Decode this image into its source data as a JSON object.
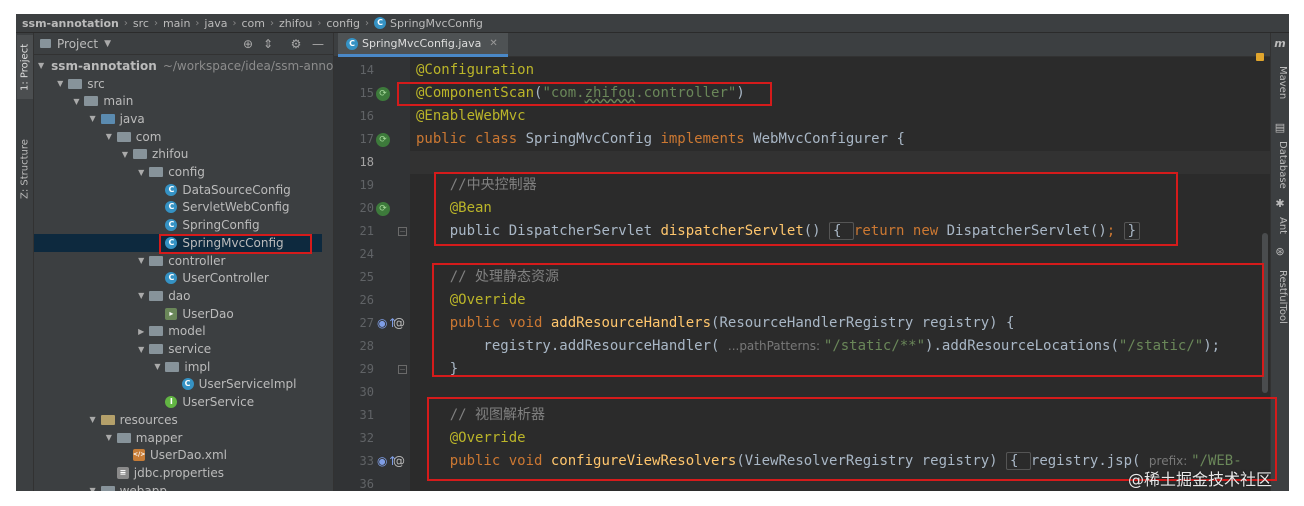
{
  "breadcrumb": [
    "ssm-annotation",
    "src",
    "main",
    "java",
    "com",
    "zhifou",
    "config",
    "SpringMvcConfig"
  ],
  "left_strip": {
    "project_tab": "1: Project",
    "structure_tab": "Z: Structure"
  },
  "project_panel": {
    "title": "Project",
    "tree": [
      {
        "label": "ssm-annotation",
        "path": "~/workspace/idea/ssm-anno",
        "icon": "folder-icon",
        "level": 0,
        "state": "open"
      },
      {
        "label": "src",
        "icon": "folder-icon",
        "level": 1,
        "state": "open"
      },
      {
        "label": "main",
        "icon": "folder-icon",
        "level": 2,
        "state": "open"
      },
      {
        "label": "java",
        "icon": "source-folder-icon",
        "level": 3,
        "state": "open"
      },
      {
        "label": "com",
        "icon": "package-icon",
        "level": 4,
        "state": "open"
      },
      {
        "label": "zhifou",
        "icon": "package-icon",
        "level": 5,
        "state": "open"
      },
      {
        "label": "config",
        "icon": "package-icon",
        "level": 6,
        "state": "open"
      },
      {
        "label": "DataSourceConfig",
        "icon": "class-icon",
        "level": 7,
        "state": "leaf"
      },
      {
        "label": "ServletWebConfig",
        "icon": "class-icon",
        "level": 7,
        "state": "leaf"
      },
      {
        "label": "SpringConfig",
        "icon": "class-icon",
        "level": 7,
        "state": "leaf"
      },
      {
        "label": "SpringMvcConfig",
        "icon": "class-icon",
        "level": 7,
        "state": "leaf",
        "selected": true
      },
      {
        "label": "controller",
        "icon": "package-icon",
        "level": 6,
        "state": "open"
      },
      {
        "label": "UserController",
        "icon": "class-icon",
        "level": 7,
        "state": "leaf"
      },
      {
        "label": "dao",
        "icon": "package-icon",
        "level": 6,
        "state": "open"
      },
      {
        "label": "UserDao",
        "icon": "mapper-icon",
        "level": 7,
        "state": "leaf"
      },
      {
        "label": "model",
        "icon": "package-icon",
        "level": 6,
        "state": "closed"
      },
      {
        "label": "service",
        "icon": "package-icon",
        "level": 6,
        "state": "open"
      },
      {
        "label": "impl",
        "icon": "package-icon",
        "level": 7,
        "state": "open"
      },
      {
        "label": "UserServiceImpl",
        "icon": "class-icon",
        "level": 8,
        "state": "leaf"
      },
      {
        "label": "UserService",
        "icon": "interface-icon",
        "level": 7,
        "state": "leaf"
      },
      {
        "label": "resources",
        "icon": "resources-folder-icon",
        "level": 3,
        "state": "open"
      },
      {
        "label": "mapper",
        "icon": "folder-icon",
        "level": 4,
        "state": "open"
      },
      {
        "label": "UserDao.xml",
        "icon": "xml-icon",
        "level": 5,
        "state": "leaf"
      },
      {
        "label": "jdbc.properties",
        "icon": "properties-icon",
        "level": 4,
        "state": "leaf"
      },
      {
        "label": "webapp",
        "icon": "folder-icon",
        "level": 3,
        "state": "open"
      }
    ]
  },
  "editor": {
    "tab_label": "SpringMvcConfig.java",
    "lines": [
      {
        "n": "14",
        "parts": [
          [
            "an",
            "@Configuration"
          ]
        ]
      },
      {
        "n": "15",
        "parts": [
          [
            "an",
            "@ComponentScan"
          ],
          [
            "",
            "("
          ],
          [
            "st",
            "\"com."
          ],
          [
            "stu",
            "zhifou"
          ],
          [
            "st",
            ".controller\""
          ],
          [
            "",
            ")"
          ]
        ],
        "marker": "bean"
      },
      {
        "n": "16",
        "parts": [
          [
            "an",
            "@EnableWebMvc"
          ]
        ]
      },
      {
        "n": "17",
        "parts": [
          [
            "kw",
            "public class "
          ],
          [
            "",
            "SpringMvcConfig "
          ],
          [
            "kw",
            "implements "
          ],
          [
            "",
            "WebMvcConfigurer {"
          ]
        ],
        "marker": "bean"
      },
      {
        "n": "18",
        "parts": [],
        "current": true
      },
      {
        "n": "19",
        "parts": [
          [
            "",
            "    "
          ],
          [
            "cm",
            "//中央控制器"
          ]
        ]
      },
      {
        "n": "20",
        "parts": [
          [
            "",
            "    "
          ],
          [
            "an",
            "@Bean"
          ]
        ],
        "marker": "bean"
      },
      {
        "n": "21",
        "parts": [
          [
            "",
            "    "
          ],
          [
            "",
            "public "
          ],
          [
            "",
            "DispatcherServlet "
          ],
          [
            "fn",
            "dispatcherServlet"
          ],
          [
            "",
            "() "
          ],
          [
            "fb",
            "{ "
          ],
          [
            "kw",
            "return new "
          ],
          [
            "",
            "DispatcherServlet()"
          ],
          [
            "kw",
            "; "
          ],
          [
            "fb",
            "}"
          ]
        ],
        "fold": true
      },
      {
        "n": "24",
        "parts": []
      },
      {
        "n": "25",
        "parts": [
          [
            "",
            "    "
          ],
          [
            "cm",
            "// 处理静态资源"
          ]
        ]
      },
      {
        "n": "26",
        "parts": [
          [
            "",
            "    "
          ],
          [
            "an",
            "@Override"
          ]
        ]
      },
      {
        "n": "27",
        "parts": [
          [
            "",
            "    "
          ],
          [
            "kw",
            "public void "
          ],
          [
            "fn",
            "addResourceHandlers"
          ],
          [
            "",
            "(ResourceHandlerRegistry registry) {"
          ]
        ],
        "marker": "override",
        "fold": true
      },
      {
        "n": "28",
        "parts": [
          [
            "",
            "        registry.addResourceHandler( "
          ],
          [
            "hint",
            "...pathPatterns: "
          ],
          [
            "st",
            "\"/static/**\""
          ],
          [
            "",
            ").addResourceLocations("
          ],
          [
            "st",
            "\"/static/\""
          ],
          [
            "",
            ");"
          ]
        ]
      },
      {
        "n": "29",
        "parts": [
          [
            "",
            "    }"
          ]
        ],
        "fold": true
      },
      {
        "n": "30",
        "parts": []
      },
      {
        "n": "31",
        "parts": [
          [
            "",
            "    "
          ],
          [
            "cm",
            "// 视图解析器"
          ]
        ]
      },
      {
        "n": "32",
        "parts": [
          [
            "",
            "    "
          ],
          [
            "an",
            "@Override"
          ]
        ]
      },
      {
        "n": "33",
        "parts": [
          [
            "",
            "    "
          ],
          [
            "kw",
            "public void "
          ],
          [
            "fn",
            "configureViewResolvers"
          ],
          [
            "",
            "(ViewResolverRegistry registry) "
          ],
          [
            "fb",
            "{ "
          ],
          [
            "",
            "registry.jsp( "
          ],
          [
            "hint",
            "prefix: "
          ],
          [
            "st",
            "\"/WEB-"
          ]
        ],
        "marker": "override",
        "fold": true
      },
      {
        "n": "36",
        "parts": []
      }
    ]
  },
  "right_strip": {
    "maven": "Maven",
    "database": "Database",
    "ant": "Ant",
    "restful": "RestfulTool"
  },
  "watermark": "@稀土掘金技术社区",
  "colors": {
    "bg": "#2b2b2b",
    "panel": "#3c3f41",
    "selection": "#0d293e",
    "highlight_box": "#d51b1b",
    "accent": "#4a88c7"
  }
}
